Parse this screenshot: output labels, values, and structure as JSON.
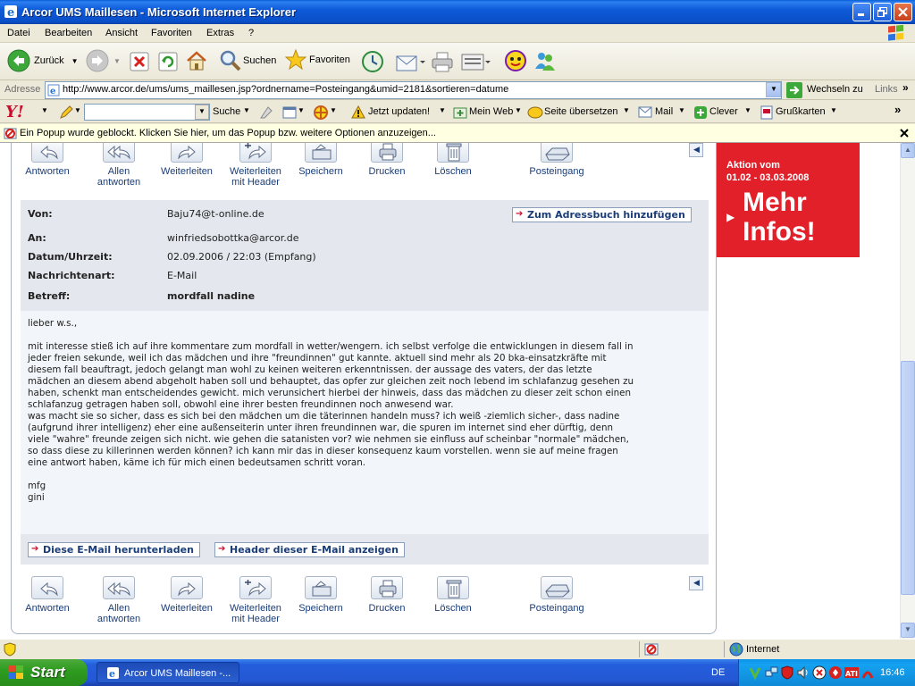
{
  "window": {
    "title": "Arcor UMS Maillesen - Microsoft Internet Explorer"
  },
  "menu": [
    "Datei",
    "Bearbeiten",
    "Ansicht",
    "Favoriten",
    "Extras",
    "?"
  ],
  "toolbar": {
    "back": "Zurück",
    "search": "Suchen",
    "favorites": "Favoriten"
  },
  "address": {
    "label": "Adresse",
    "url": "http://www.arcor.de/ums/ums_maillesen.jsp?ordnername=Posteingang&umid=2181&sortieren=datume",
    "go": "Wechseln zu",
    "links": "Links"
  },
  "yahoo": {
    "search_label": "Suche",
    "update": "Jetzt updaten!",
    "myweb": "Mein Web",
    "translate": "Seite übersetzen",
    "mail": "Mail",
    "clever": "Clever",
    "cards": "Grußkarten"
  },
  "popup": {
    "text": "Ein Popup wurde geblockt. Klicken Sie hier, um das Popup bzw. weitere Optionen anzuzeigen..."
  },
  "actions": [
    {
      "label": "Antworten"
    },
    {
      "label": "Allen\nantworten"
    },
    {
      "label": "Weiterleiten"
    },
    {
      "label": "Weiterleiten\nmit Header"
    },
    {
      "label": "Speichern"
    },
    {
      "label": "Drucken"
    },
    {
      "label": "Löschen"
    },
    {
      "label": "Posteingang"
    }
  ],
  "mail": {
    "from_label": "Von:",
    "from": "Baju74@t-online.de",
    "addressbook": "Zum Adressbuch hinzufügen",
    "to_label": "An:",
    "to": "winfriedsobottka@arcor.de",
    "date_label": "Datum/Uhrzeit:",
    "date": "02.09.2006 / 22:03 (Empfang)",
    "type_label": "Nachrichtenart:",
    "type": "E-Mail",
    "subject_label": "Betreff:",
    "subject": "mordfall nadine",
    "body": "lieber w.s.,\n\nmit interesse stieß ich auf ihre kommentare zum mordfall in wetter/wengern. ich selbst verfolge die entwicklungen in diesem fall in\njeder freien sekunde, weil ich das mädchen und ihre \"freundinnen\" gut kannte. aktuell sind mehr als 20 bka-einsatzkräfte mit\ndiesem fall beauftragt, jedoch gelangt man wohl zu keinen weiteren erkenntnissen. der aussage des vaters, der das letzte\nmädchen an diesem abend abgeholt haben soll und behauptet, das opfer zur gleichen zeit noch lebend im schlafanzug gesehen zu\nhaben, schenkt man entscheidendes gewicht. mich verunsichert hierbei der hinweis, dass das mädchen zu dieser zeit schon einen\nschlafanzug getragen haben soll, obwohl eine ihrer besten freundinnen noch anwesend war.\nwas macht sie so sicher, dass es sich bei den mädchen um die täterinnen handeln muss? ich weiß -ziemlich sicher-, dass nadine\n(aufgrund ihrer intelligenz) eher eine außenseiterin unter ihren freundinnen war, die spuren im internet sind eher dürftig, denn\nviele \"wahre\" freunde zeigen sich nicht. wie gehen die satanisten vor? wie nehmen sie einfluss auf scheinbar \"normale\" mädchen,\nso dass diese zu killerinnen werden können? ich kann mir das in dieser konsequenz kaum vorstellen. wenn sie auf meine fragen\neine antwort haben, käme ich für mich einen bedeutsamen schritt voran.\n\nmfg\ngini",
    "download": "Diese E-Mail herunterladen",
    "show_header": "Header dieser E-Mail anzeigen"
  },
  "ad": {
    "line1": "Aktion vom",
    "line2": "01.02 - 03.03.2008",
    "cta1": "Mehr",
    "cta2": "Infos!"
  },
  "status": {
    "zone": "Internet"
  },
  "taskbar": {
    "start": "Start",
    "task": "Arcor UMS Maillesen -...",
    "lang": "DE",
    "clock": "16:46"
  }
}
